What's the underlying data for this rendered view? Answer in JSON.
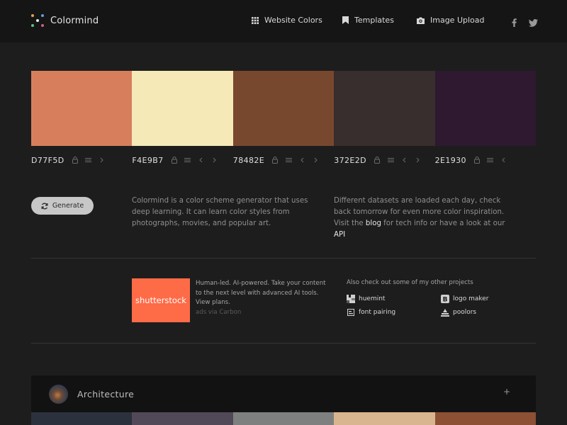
{
  "header": {
    "brand": "Colormind",
    "nav": [
      {
        "label": "Website Colors",
        "icon": "grid-icon"
      },
      {
        "label": "Templates",
        "icon": "bookmark-icon"
      },
      {
        "label": "Image Upload",
        "icon": "camera-icon"
      }
    ],
    "social": [
      "facebook-icon",
      "twitter-icon"
    ]
  },
  "palette": [
    {
      "hex": "D77F5D",
      "color": "#D77F5D"
    },
    {
      "hex": "F4E9B7",
      "color": "#F4E9B7"
    },
    {
      "hex": "78482E",
      "color": "#78482E"
    },
    {
      "hex": "372E2D",
      "color": "#372E2D"
    },
    {
      "hex": "2E1930",
      "color": "#2E1930"
    }
  ],
  "generate_label": "Generate",
  "intro": {
    "left": "Colormind is a color scheme generator that uses deep learning. It can learn color styles from photographs, movies, and popular art.",
    "right_part1": "Different datasets are loaded each day, check back tomorrow for even more color inspiration. Visit the",
    "blog_link": "blog",
    "right_part2": "for tech info or have a look at our",
    "api_link": "API"
  },
  "ad": {
    "brand": "shutterstock",
    "text": "Human-led. AI-powered. Take your content to the next level with advanced AI tools. View plans.",
    "via": "ads via Carbon",
    "color": "#FE6B47"
  },
  "others": {
    "title": "Also check out some of my other projects",
    "items": [
      {
        "label": "huemint",
        "icon": "huemint-icon"
      },
      {
        "label": "logo maker",
        "icon": "logo-maker-icon"
      },
      {
        "label": "font pairing",
        "icon": "font-pairing-icon"
      },
      {
        "label": "poolors",
        "icon": "poolors-icon"
      }
    ]
  },
  "card": {
    "title": "Architecture",
    "expand": "+",
    "colors": [
      "#2B313D",
      "#514858",
      "#7D807E",
      "#D9B58F",
      "#8C5035"
    ]
  }
}
